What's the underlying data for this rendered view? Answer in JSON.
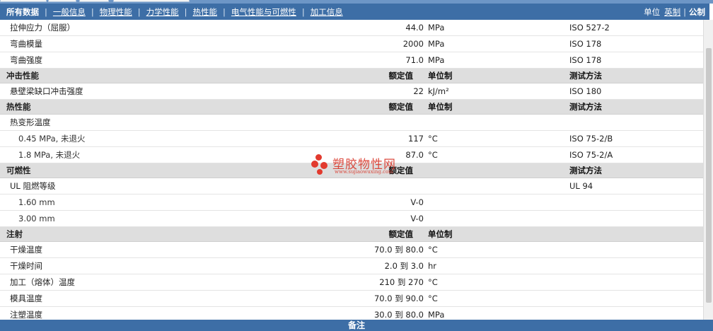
{
  "nav": {
    "items": [
      "所有数据",
      "一般信息",
      "物理性能",
      "力学性能",
      "热性能",
      "电气性能与可燃性",
      "加工信息"
    ],
    "active_index": 0,
    "unit_label": "单位",
    "unit_options": [
      "英制",
      "公制"
    ],
    "unit_active": "公制"
  },
  "rows": {
    "r0": {
      "name": "拉伸应力（屈服）",
      "value": "44.0",
      "unit": "MPa",
      "test": "ISO 527-2"
    },
    "r1": {
      "name": "弯曲模量",
      "value": "2000",
      "unit": "MPa",
      "test": "ISO 178"
    },
    "r2": {
      "name": "弯曲强度",
      "value": "71.0",
      "unit": "MPa",
      "test": "ISO 178"
    },
    "s_impact": {
      "name": "冲击性能",
      "col_value": "额定值",
      "col_unit": "单位制",
      "col_test": "测试方法"
    },
    "r3": {
      "name": "悬壁梁缺口冲击强度",
      "value": "22",
      "unit": "kJ/m²",
      "test": "ISO 180"
    },
    "s_thermal": {
      "name": "热性能",
      "col_value": "额定值",
      "col_unit": "单位制",
      "col_test": "测试方法"
    },
    "r4": {
      "name": "热变形温度",
      "value": "",
      "unit": "",
      "test": ""
    },
    "r5": {
      "name": "0.45 MPa, 未退火",
      "value": "117",
      "unit": "°C",
      "test": "ISO 75-2/B"
    },
    "r6": {
      "name": "1.8 MPa, 未退火",
      "value": "87.0",
      "unit": "°C",
      "test": "ISO 75-2/A"
    },
    "s_flame": {
      "name": "可燃性",
      "col_value": "额定值",
      "col_unit": "",
      "col_test": "测试方法"
    },
    "r7": {
      "name": "UL 阻燃等级",
      "value": "",
      "unit": "",
      "test": "UL 94"
    },
    "r8": {
      "name": "1.60 mm",
      "value": "V-0",
      "unit": "",
      "test": ""
    },
    "r9": {
      "name": "3.00 mm",
      "value": "V-0",
      "unit": "",
      "test": ""
    },
    "s_inject": {
      "name": "注射",
      "col_value": "额定值",
      "col_unit": "单位制",
      "col_test": ""
    },
    "r10": {
      "name": "干燥温度",
      "value": "70.0 到  80.0",
      "unit": "°C",
      "test": ""
    },
    "r11": {
      "name": "干燥时间",
      "value": "2.0 到  3.0",
      "unit": "hr",
      "test": ""
    },
    "r12": {
      "name": "加工（熔体）温度",
      "value": "210 到  270",
      "unit": "°C",
      "test": ""
    },
    "r13": {
      "name": "模具温度",
      "value": "70.0 到  90.0",
      "unit": "°C",
      "test": ""
    },
    "r14": {
      "name": "注塑温度",
      "value": "30.0 到  80.0",
      "unit": "MPa",
      "test": ""
    }
  },
  "footer": {
    "label": "备注"
  },
  "watermark": {
    "title": "塑胶物性网",
    "url": "www.sujiaowuxing.com"
  },
  "colors": {
    "nav_bg": "#3d6ea6",
    "section_bg": "#dedede",
    "watermark": "#d9382b"
  }
}
